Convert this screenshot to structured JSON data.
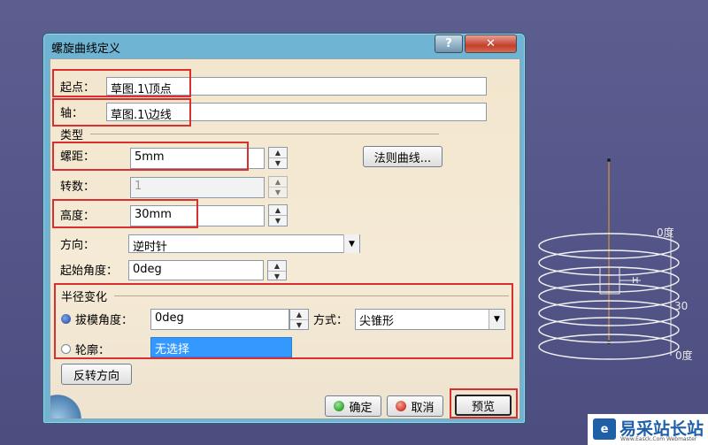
{
  "window": {
    "title": "螺旋曲线定义",
    "help_glyph": "?",
    "close_glyph": "✕"
  },
  "form": {
    "start_point": {
      "label": "起点：",
      "value": "草图.1\\顶点"
    },
    "axis": {
      "label": "轴：",
      "value": "草图.1\\边线"
    },
    "type_section": "类型",
    "pitch": {
      "label": "螺距：",
      "value": "5mm"
    },
    "law_curve_button": "法则曲线...",
    "revolutions": {
      "label": "转数：",
      "value": "1"
    },
    "height": {
      "label": "高度：",
      "value": "30mm"
    },
    "direction": {
      "label": "方向：",
      "value": "逆时针"
    },
    "start_angle": {
      "label": "起始角度：",
      "value": "0deg"
    },
    "radius_section": "半径变化",
    "taper_angle": {
      "label": "拔模角度：",
      "value": "0deg",
      "selected": true
    },
    "method": {
      "label": "方式：",
      "value": "尖锥形"
    },
    "profile": {
      "label": "轮廓：",
      "value": "无选择",
      "selected": false
    },
    "reverse_button": "反转方向"
  },
  "footer": {
    "ok": "确定",
    "cancel": "取消",
    "preview": "预览"
  },
  "scene": {
    "label_top": "0度",
    "label_height": "30",
    "label_bottom": "0度",
    "label_h": "H"
  },
  "watermark": {
    "text": "易采站长站",
    "subtext": "Www.Easck.Com Webmaster"
  },
  "colors": {
    "highlight_box": "#d9302f",
    "selection_blue": "#3399ff",
    "ok_dot": "#2fa62f",
    "cancel_dot": "#d23a2a"
  }
}
